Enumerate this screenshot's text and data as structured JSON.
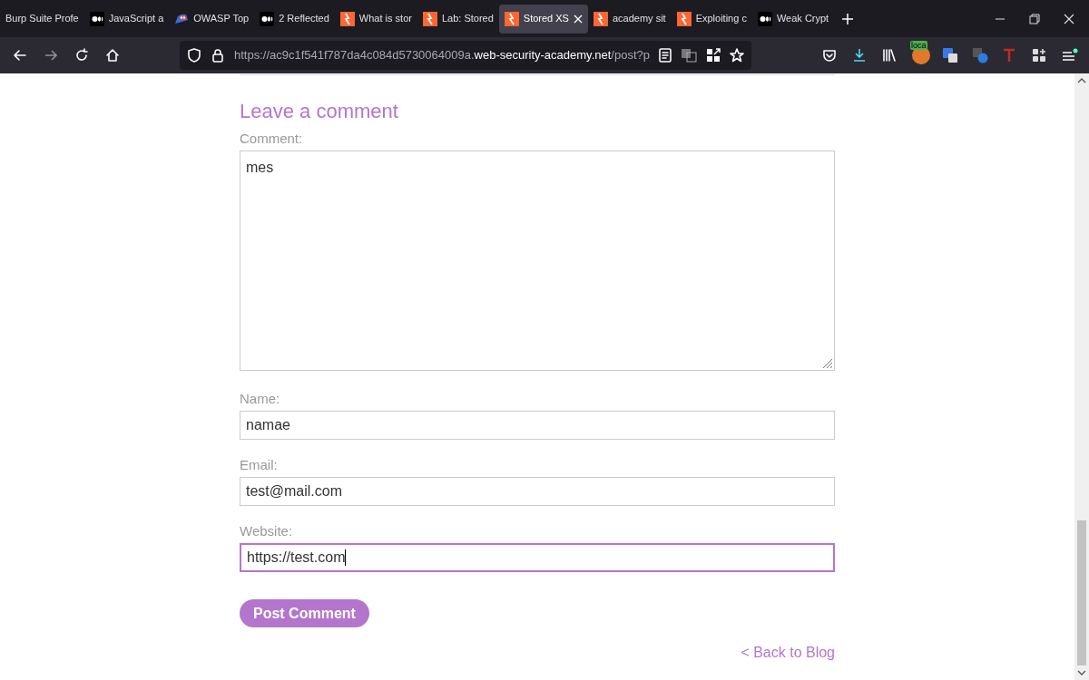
{
  "tabs": [
    {
      "title": "Burp Suite Profe",
      "kind": "none",
      "selected": false
    },
    {
      "title": "JavaScript a",
      "kind": "medium",
      "selected": false
    },
    {
      "title": "OWASP Top",
      "kind": "owasp",
      "selected": false
    },
    {
      "title": "2 Reflected",
      "kind": "medium",
      "selected": false
    },
    {
      "title": "What is stor",
      "kind": "bolt",
      "selected": false
    },
    {
      "title": "Lab: Stored",
      "kind": "bolt",
      "selected": false
    },
    {
      "title": "Stored XS",
      "kind": "bolt",
      "selected": true
    },
    {
      "title": "academy sit",
      "kind": "bolt",
      "selected": false
    },
    {
      "title": "Exploiting c",
      "kind": "bolt",
      "selected": false
    },
    {
      "title": "Weak Crypt",
      "kind": "medium",
      "selected": false
    }
  ],
  "address_bar": {
    "url_prefix": "https://ac9c1f541f787da4c084d5730064009a.",
    "url_domain": "web-security-academy.net",
    "url_path": "/post?p"
  },
  "extension_badge": "loca",
  "comment_form": {
    "heading": "Leave a comment",
    "fields": [
      {
        "label": "Comment:",
        "kind": "textarea",
        "value": "mes",
        "focused": false
      },
      {
        "label": "Name:",
        "kind": "input",
        "value": "namae",
        "focused": false
      },
      {
        "label": "Email:",
        "kind": "input",
        "value": "test@mail.com",
        "focused": false
      },
      {
        "label": "Website:",
        "kind": "input",
        "value": "https://test.com",
        "focused": true
      }
    ],
    "submit": "Post Comment"
  },
  "back_link": "< Back to Blog"
}
